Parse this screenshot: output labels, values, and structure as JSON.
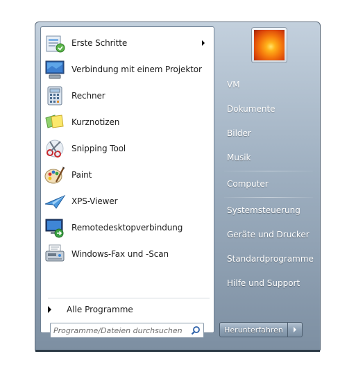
{
  "programs": [
    {
      "label": "Erste Schritte",
      "icon": "getting-started-icon",
      "has_submenu": true
    },
    {
      "label": "Verbindung mit einem Projektor",
      "icon": "projector-icon",
      "has_submenu": false
    },
    {
      "label": "Rechner",
      "icon": "calculator-icon",
      "has_submenu": false
    },
    {
      "label": "Kurznotizen",
      "icon": "sticky-notes-icon",
      "has_submenu": false
    },
    {
      "label": "Snipping Tool",
      "icon": "scissors-icon",
      "has_submenu": false
    },
    {
      "label": "Paint",
      "icon": "paint-palette-icon",
      "has_submenu": false
    },
    {
      "label": "XPS-Viewer",
      "icon": "xps-viewer-icon",
      "has_submenu": false
    },
    {
      "label": "Remotedesktopverbindung",
      "icon": "remote-desktop-icon",
      "has_submenu": false
    },
    {
      "label": "Windows-Fax und -Scan",
      "icon": "fax-scanner-icon",
      "has_submenu": false
    }
  ],
  "all_programs_label": "Alle Programme",
  "search": {
    "placeholder": "Programme/Dateien durchsuchen",
    "value": ""
  },
  "user": {
    "picture_icon": "flower-user-picture-icon"
  },
  "right_pane": {
    "user_folder": "VM",
    "documents": "Dokumente",
    "pictures": "Bilder",
    "music": "Musik",
    "computer": "Computer",
    "control_panel": "Systemsteuerung",
    "devices": "Geräte und Drucker",
    "default_programs": "Standardprogramme",
    "help": "Hilfe und Support"
  },
  "shutdown": {
    "label": "Herunterfahren"
  },
  "colors": {
    "accent": "#6f8194",
    "right_text": "#ffffff"
  }
}
